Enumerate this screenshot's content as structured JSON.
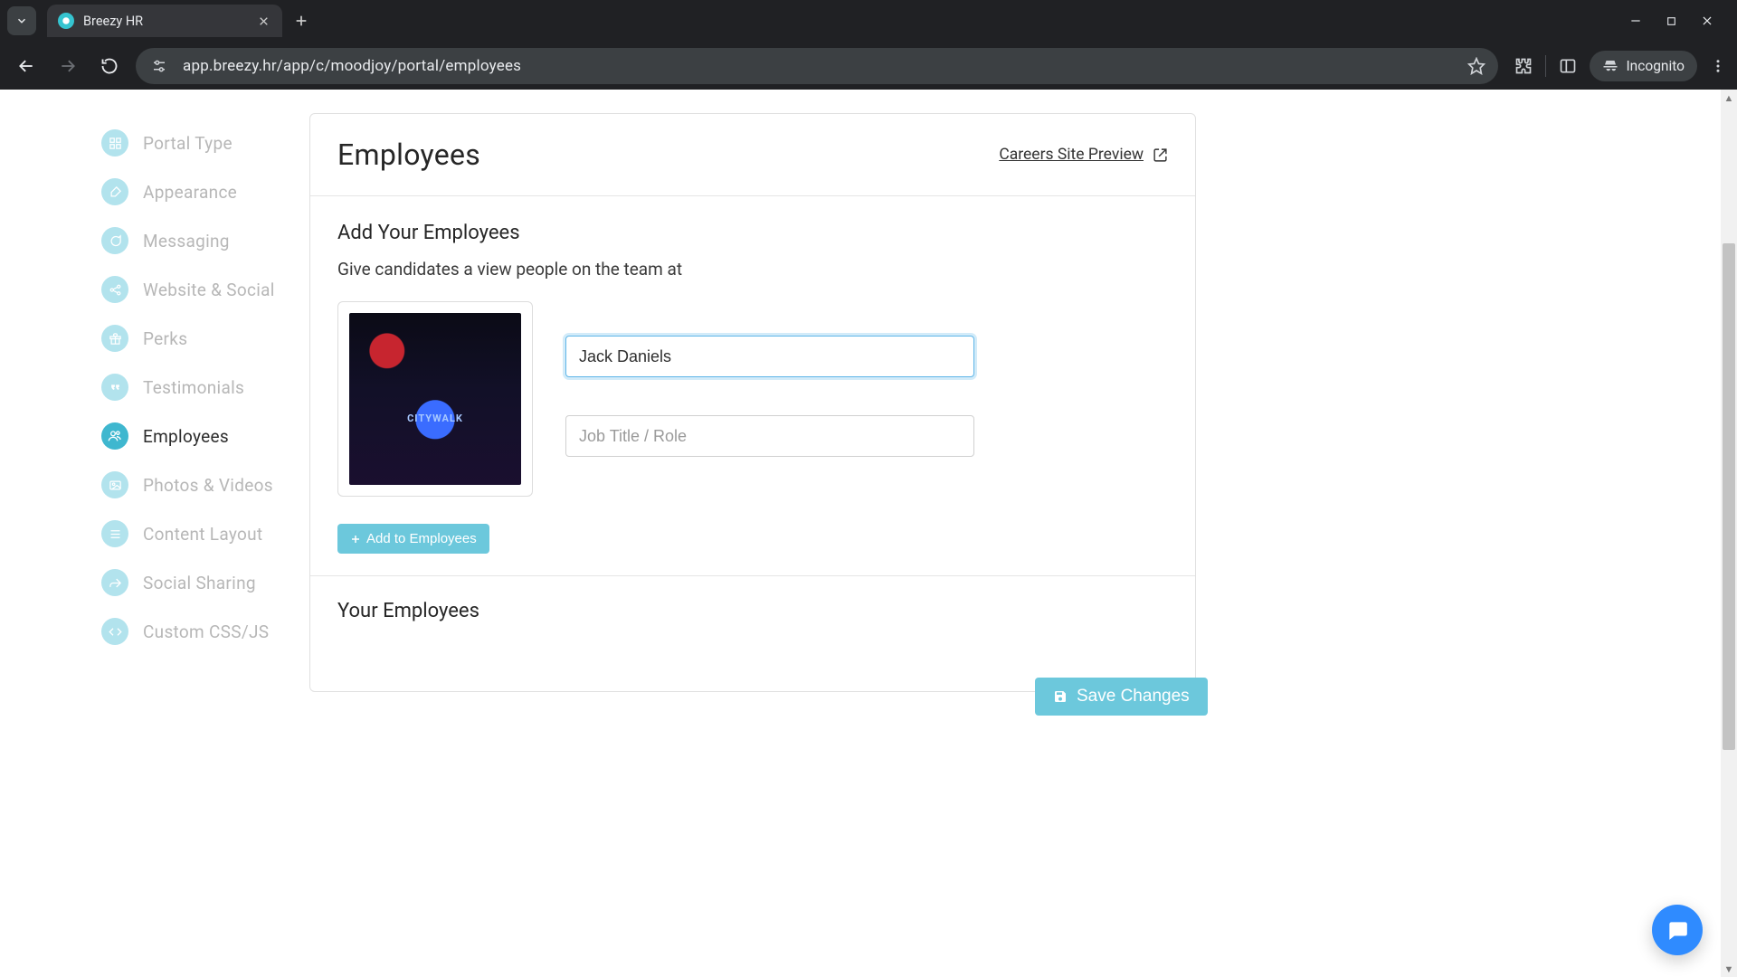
{
  "browser": {
    "tab_title": "Breezy HR",
    "url": "app.breezy.hr/app/c/moodjoy/portal/employees",
    "incognito_label": "Incognito"
  },
  "sidebar": {
    "items": [
      {
        "label": "Portal Type",
        "icon": "grid-icon"
      },
      {
        "label": "Appearance",
        "icon": "brush-icon"
      },
      {
        "label": "Messaging",
        "icon": "chat-icon"
      },
      {
        "label": "Website & Social",
        "icon": "share-icon"
      },
      {
        "label": "Perks",
        "icon": "gift-icon"
      },
      {
        "label": "Testimonials",
        "icon": "quote-icon"
      },
      {
        "label": "Employees",
        "icon": "people-icon"
      },
      {
        "label": "Photos & Videos",
        "icon": "photo-icon"
      },
      {
        "label": "Content Layout",
        "icon": "layout-icon"
      },
      {
        "label": "Social Sharing",
        "icon": "forward-icon"
      },
      {
        "label": "Custom CSS/JS",
        "icon": "code-icon"
      }
    ],
    "active_index": 6
  },
  "header": {
    "title": "Employees",
    "preview_link": "Careers Site Preview"
  },
  "add_section": {
    "heading": "Add Your Employees",
    "subheading": "Give candidates a view people on the team at",
    "name_value": "Jack Daniels",
    "role_placeholder": "Job Title / Role",
    "add_button": "Add to Employees"
  },
  "list_section": {
    "heading": "Your Employees"
  },
  "footer": {
    "save_button": "Save Changes"
  }
}
